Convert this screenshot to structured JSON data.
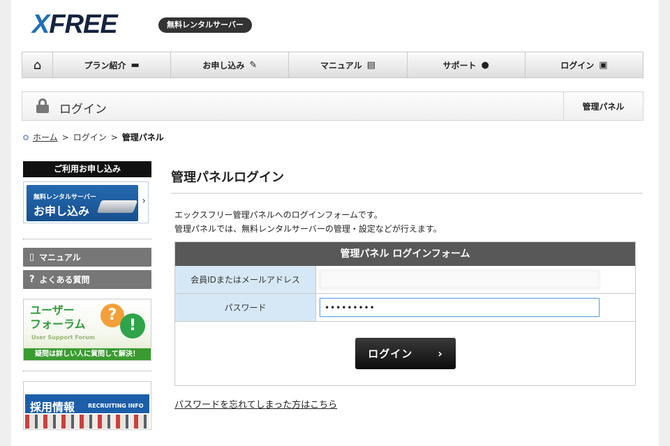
{
  "header": {
    "logo": "XFREE",
    "logo_x": "X",
    "logo_rest": "FREE",
    "tagline": "無料レンタルサーバー"
  },
  "nav": {
    "home_icon": "home-icon",
    "items": [
      {
        "label": "プラン紹介",
        "icon": "server-icon"
      },
      {
        "label": "お申し込み",
        "icon": "pencil-icon"
      },
      {
        "label": "マニュアル",
        "icon": "book-icon"
      },
      {
        "label": "サポート",
        "icon": "person-icon"
      },
      {
        "label": "ログイン",
        "icon": "lock-icon"
      }
    ]
  },
  "titlebar": {
    "title": "ログイン",
    "panel_button": "管理パネル"
  },
  "breadcrumb": {
    "home": "ホーム",
    "sep": ">",
    "login": "ログイン",
    "current": "管理パネル"
  },
  "sidebar": {
    "apply_heading": "ご利用お申し込み",
    "apply_banner_small": "無料レンタルサーバー",
    "apply_banner_big": "お申し込み",
    "manual": "マニュアル",
    "faq": "よくある質問",
    "forum_title_1": "ユーザー",
    "forum_title_2": "フォーラム",
    "forum_sub": "User Support Forum",
    "forum_bottom": "疑問は詳しい人に質問して解決！",
    "recruit_title": "採用情報",
    "recruit_sub": "RECRUITING INFO"
  },
  "main": {
    "title": "管理パネルログイン",
    "intro_1": "エックスフリー管理パネルへのログインフォームです。",
    "intro_2": "管理パネルでは、無料レンタルサーバーの管理・設定などが行えます。",
    "form_title": "管理パネル ログインフォーム",
    "id_label": "会員IDまたはメールアドレス",
    "id_value": "",
    "password_label": "パスワード",
    "password_value": "•••••••••",
    "login_button": "ログイン",
    "forgot_link": "パスワードを忘れてしまった方はこちら"
  },
  "colors": {
    "brand_blue": "#1f6fb8",
    "form_header": "#585858",
    "label_bg": "#d6e8f5",
    "forum_green": "#3a9b30",
    "recruit_blue": "#1c5ea8"
  }
}
